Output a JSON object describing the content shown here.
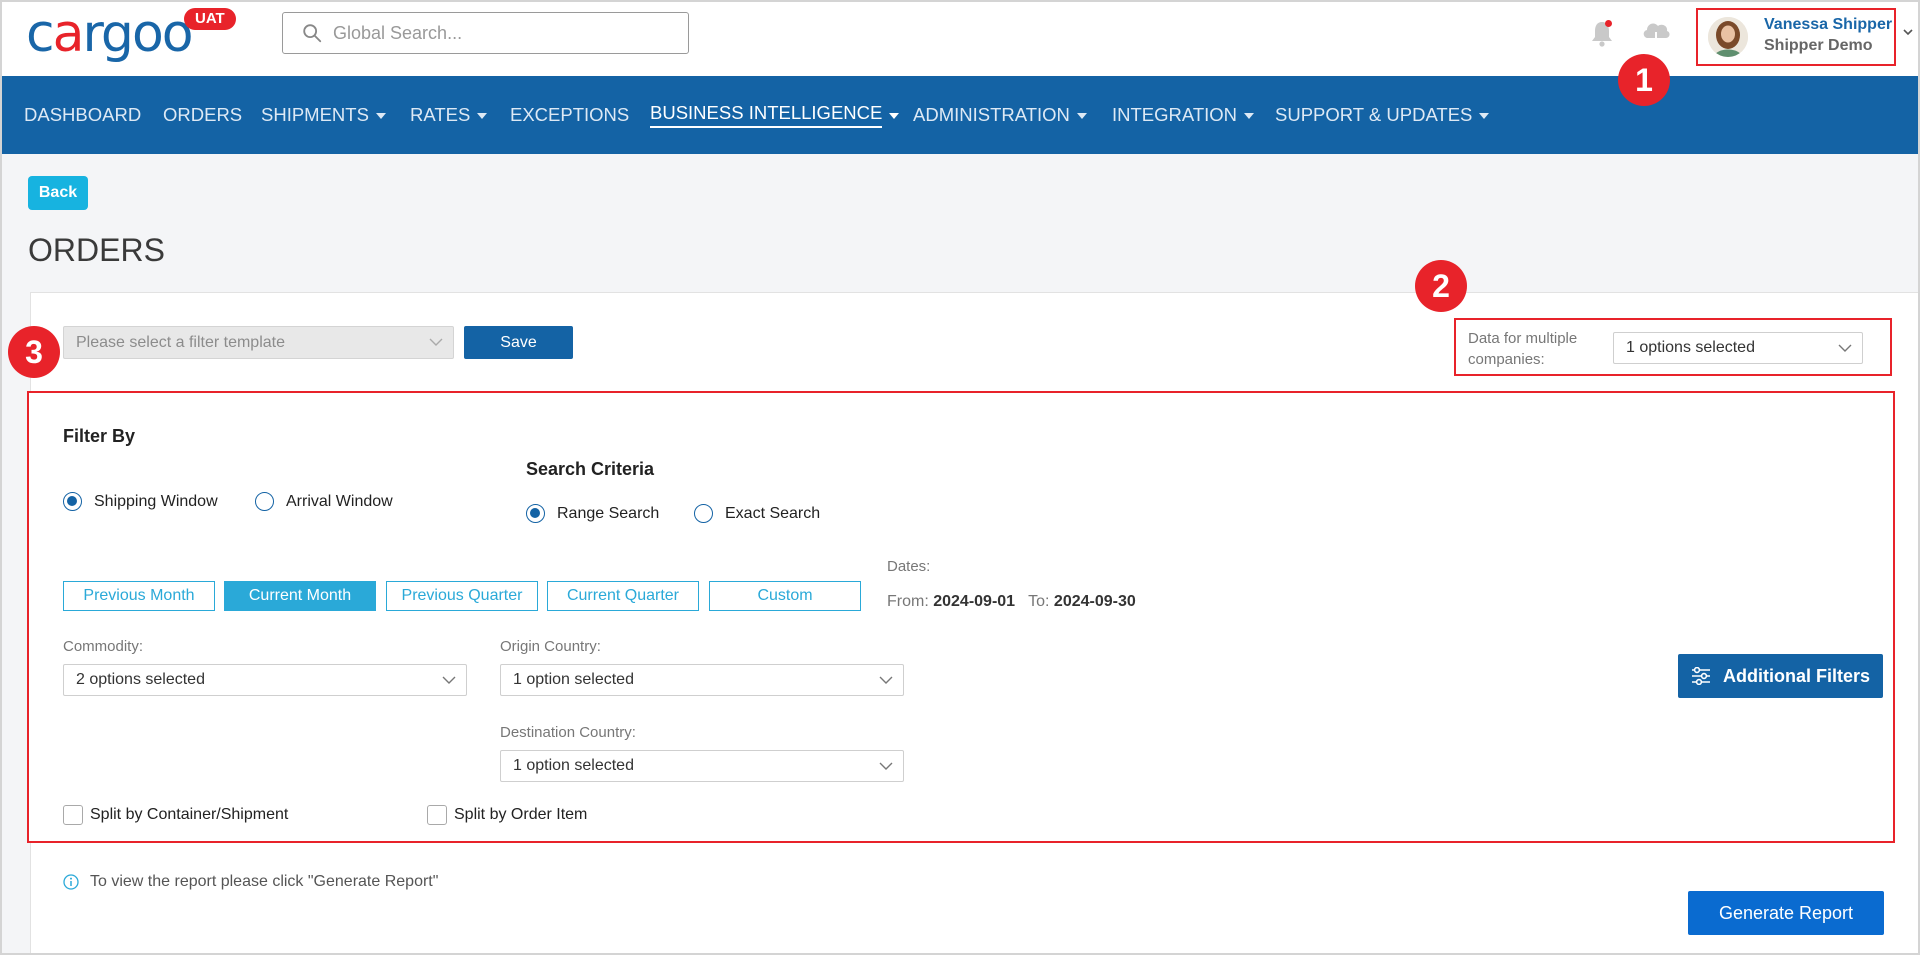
{
  "header": {
    "logo_text": "cargoo",
    "env_badge": "UAT",
    "search_placeholder": "Global Search...",
    "user": {
      "name": "Vanessa Shipper",
      "company": "Shipper Demo"
    }
  },
  "nav": {
    "items": [
      {
        "label": "DASHBOARD",
        "dropdown": false
      },
      {
        "label": "ORDERS",
        "dropdown": false
      },
      {
        "label": "SHIPMENTS",
        "dropdown": true
      },
      {
        "label": "RATES",
        "dropdown": true
      },
      {
        "label": "EXCEPTIONS",
        "dropdown": false
      },
      {
        "label": "BUSINESS INTELLIGENCE",
        "dropdown": true,
        "active": true
      },
      {
        "label": "ADMINISTRATION",
        "dropdown": true
      },
      {
        "label": "INTEGRATION",
        "dropdown": true
      },
      {
        "label": "SUPPORT & UPDATES",
        "dropdown": true
      }
    ]
  },
  "page": {
    "back_label": "Back",
    "title": "ORDERS",
    "template_placeholder": "Please select a filter template",
    "save_label": "Save",
    "multi_company": {
      "label": "Data for multiple companies:",
      "value": "1 options selected"
    }
  },
  "filters": {
    "filter_by_label": "Filter By",
    "window_options": [
      {
        "label": "Shipping Window",
        "selected": true
      },
      {
        "label": "Arrival Window",
        "selected": false
      }
    ],
    "search_criteria_label": "Search Criteria",
    "criteria_options": [
      {
        "label": "Range Search",
        "selected": true
      },
      {
        "label": "Exact Search",
        "selected": false
      }
    ],
    "period_buttons": [
      {
        "label": "Previous Month",
        "active": false
      },
      {
        "label": "Current Month",
        "active": true
      },
      {
        "label": "Previous Quarter",
        "active": false
      },
      {
        "label": "Current Quarter",
        "active": false
      },
      {
        "label": "Custom",
        "active": false
      }
    ],
    "dates": {
      "label": "Dates:",
      "from_label": "From:",
      "from": "2024-09-01",
      "to_label": "To:",
      "to": "2024-09-30"
    },
    "commodity": {
      "label": "Commodity:",
      "value": "2 options selected"
    },
    "origin_country": {
      "label": "Origin Country:",
      "value": "1 option selected"
    },
    "destination_country": {
      "label": "Destination Country:",
      "value": "1 option selected"
    },
    "additional_filters_label": "Additional Filters",
    "split_container": {
      "label": "Split by Container/Shipment",
      "checked": false
    },
    "split_order_item": {
      "label": "Split by Order Item",
      "checked": false
    }
  },
  "footer": {
    "info_text": "To view the report please click \"Generate Report\"",
    "generate_label": "Generate Report"
  },
  "annotations": [
    "1",
    "2",
    "3"
  ],
  "colors": {
    "brand_blue": "#1463a5",
    "accent_red": "#e8232a",
    "accent_cyan": "#2aa9d8",
    "back_cyan": "#17b3e0"
  }
}
